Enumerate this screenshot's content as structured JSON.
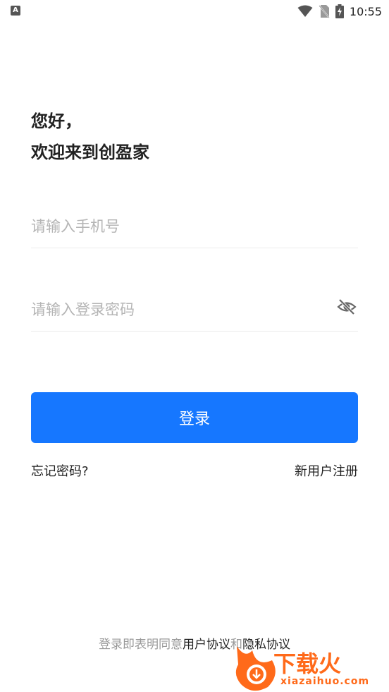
{
  "status_bar": {
    "app_icon_label": "A",
    "time": "10:55",
    "icons": [
      "wifi-icon",
      "no-sim-icon",
      "battery-charging-icon"
    ]
  },
  "greeting": {
    "line1": "您好，",
    "line2": "欢迎来到创盈家"
  },
  "phone_field": {
    "placeholder": "请输入手机号",
    "value": ""
  },
  "password_field": {
    "placeholder": "请输入登录密码",
    "value": "",
    "toggle_icon": "eye-off-icon"
  },
  "login_button": {
    "label": "登录"
  },
  "links": {
    "forgot_password": "忘记密码?",
    "register": "新用户注册"
  },
  "agreement": {
    "prefix": "登录即表明同意",
    "user_agreement": "用户协议",
    "and": "和",
    "privacy_policy": "隐私协议"
  },
  "watermark": {
    "text": "下载火",
    "url": "xiazaihuo.com"
  },
  "colors": {
    "primary": "#1677ff",
    "text": "#222222",
    "placeholder": "#b5b5b5",
    "muted": "#999999",
    "watermark": "#ff6a1a"
  }
}
